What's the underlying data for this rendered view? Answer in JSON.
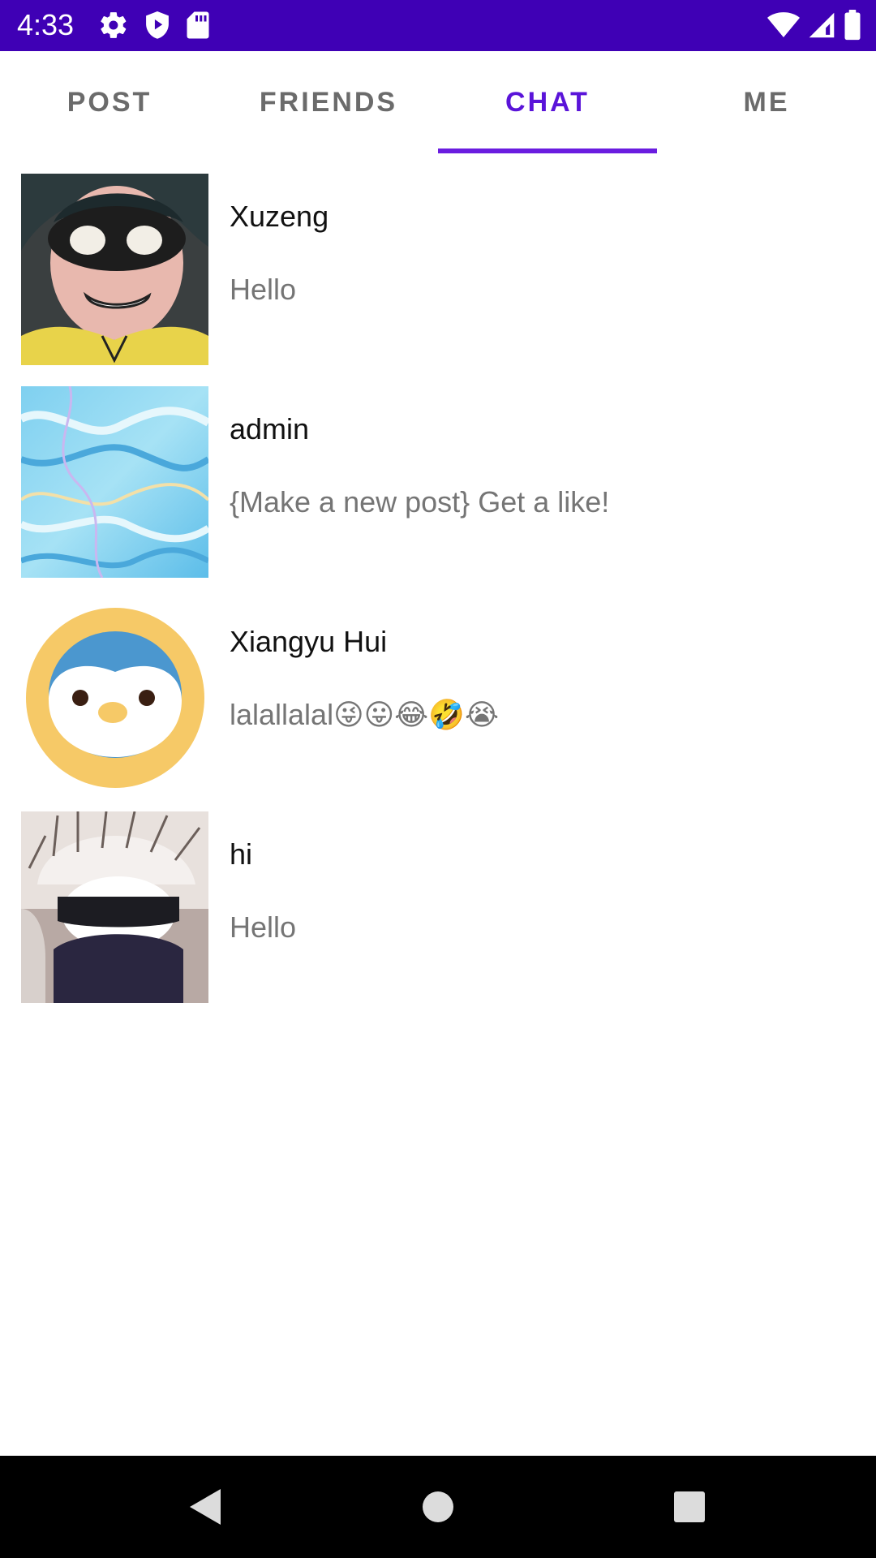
{
  "status_bar": {
    "time": "4:33",
    "color": "#3f00b5",
    "left_icons": [
      "gear-icon",
      "shield-play-icon",
      "sd-card-icon"
    ],
    "right_icons": [
      "wifi-icon",
      "cell-signal-icon",
      "battery-icon"
    ]
  },
  "tabs": [
    {
      "label": "POST",
      "active": false
    },
    {
      "label": "FRIENDS",
      "active": false
    },
    {
      "label": "CHAT",
      "active": true
    },
    {
      "label": "ME",
      "active": false
    }
  ],
  "accent_color": "#5a14d9",
  "chats": [
    {
      "name": "Xuzeng",
      "message": "Hello",
      "avatar": "comic-masked-boy-avatar"
    },
    {
      "name": "admin",
      "message": "{Make a new post} Get a like!",
      "avatar": "blue-marble-avatar"
    },
    {
      "name": "Xiangyu Hui",
      "message": "lalallalal😜😛😂🤣😭",
      "avatar": "penguin-avatar"
    },
    {
      "name": "hi",
      "message": "Hello",
      "avatar": "cat-sunglasses-avatar"
    }
  ],
  "nav_bar": {
    "buttons": [
      "back-icon",
      "home-icon",
      "recents-icon"
    ]
  }
}
